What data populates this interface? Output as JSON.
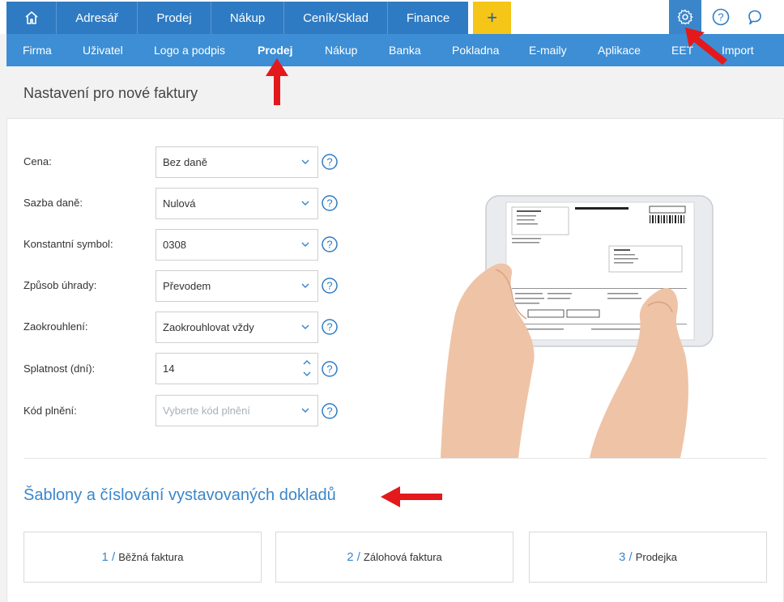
{
  "topnav": {
    "home_icon": "home-icon",
    "items": [
      "Adresář",
      "Prodej",
      "Nákup",
      "Ceník/Sklad",
      "Finance"
    ],
    "plus_label": "+",
    "gear_icon": "gear-icon",
    "help_icon": "help-circle-icon",
    "chat_icon": "chat-bubble-icon"
  },
  "subnav": {
    "items": [
      "Firma",
      "Uživatel",
      "Logo a podpis",
      "Prodej",
      "Nákup",
      "Banka",
      "Pokladna",
      "E-maily",
      "Aplikace",
      "EET",
      "Import"
    ],
    "active": "Prodej"
  },
  "page": {
    "title": "Nastavení pro nové faktury"
  },
  "form": {
    "cena": {
      "label": "Cena:",
      "value": "Bez daně"
    },
    "sazba": {
      "label": "Sazba daně:",
      "value": "Nulová"
    },
    "konst": {
      "label": "Konstantní symbol:",
      "value": "0308"
    },
    "uhrada": {
      "label": "Způsob úhrady:",
      "value": "Převodem"
    },
    "zaokr": {
      "label": "Zaokrouhlení:",
      "value": "Zaokrouhlovat vždy"
    },
    "splat": {
      "label": "Splatnost (dní):",
      "value": "14"
    },
    "kod": {
      "label": "Kód plnění:",
      "placeholder": "Vyberte kód plnění"
    }
  },
  "section": {
    "title": "Šablony a číslování vystavovaných dokladů"
  },
  "templates": [
    {
      "num": "1 /",
      "label": "Běžná faktura"
    },
    {
      "num": "2 /",
      "label": "Zálohová faktura"
    },
    {
      "num": "3 /",
      "label": "Prodejka"
    }
  ],
  "colors": {
    "nav": "#2f7bc3",
    "subnav": "#3d8ed4",
    "plus": "#f5c518",
    "accent": "#3b86ca",
    "arrow": "#e3191c"
  }
}
